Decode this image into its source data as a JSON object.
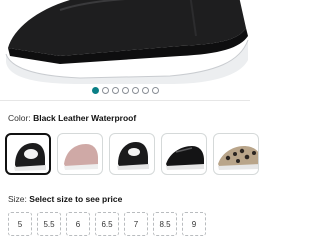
{
  "product": {
    "image_icon": "shoe-image",
    "carousel": {
      "count": 7,
      "active_index": 0
    }
  },
  "color": {
    "label": "Color:",
    "selected": "Black Leather Waterproof",
    "swatches": [
      {
        "name": "black-leather",
        "selected": true
      },
      {
        "name": "pink",
        "selected": false
      },
      {
        "name": "black-alt",
        "selected": false
      },
      {
        "name": "black-patent",
        "selected": false
      },
      {
        "name": "leopard-print",
        "selected": false
      }
    ]
  },
  "size": {
    "label": "Size:",
    "prompt": "Select size to see price",
    "options": [
      "5",
      "5.5",
      "6",
      "6.5",
      "7",
      "8.5",
      "9"
    ]
  },
  "colors": {
    "accent": "#0b7f86",
    "border": "#d5d9d9",
    "text": "#111111"
  }
}
